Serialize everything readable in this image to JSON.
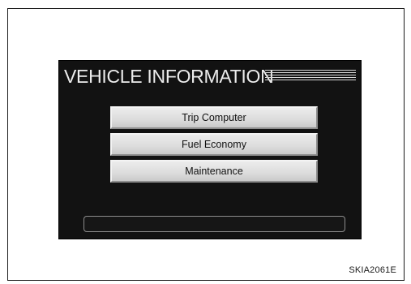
{
  "screen": {
    "title": "VEHICLE INFORMATION"
  },
  "menu": {
    "items": [
      {
        "label": "Trip Computer"
      },
      {
        "label": "Fuel Economy"
      },
      {
        "label": "Maintenance"
      }
    ]
  },
  "figure": {
    "id": "SKIA2061E"
  },
  "colors": {
    "screen_background": "#121212",
    "button_face": "#dcdcdc",
    "title_text": "#ececec",
    "frame_border": "#1a1a1a"
  }
}
